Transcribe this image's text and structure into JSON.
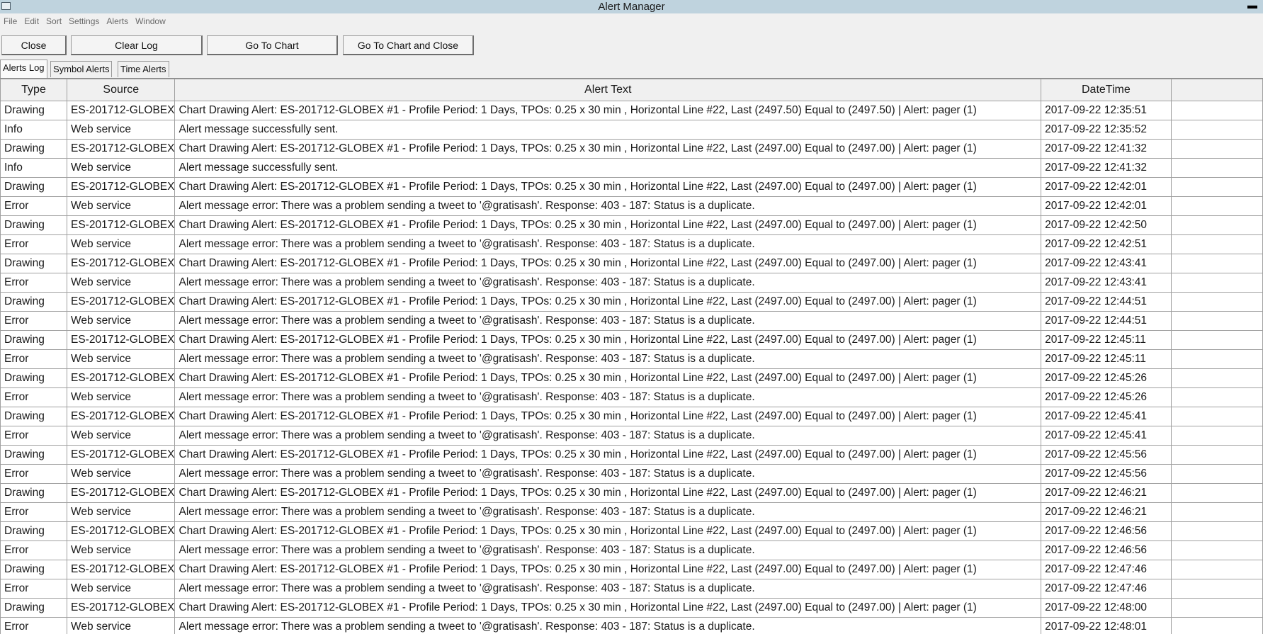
{
  "window": {
    "title": "Alert Manager",
    "minimize_label": "▬"
  },
  "menu": [
    "File",
    "Edit",
    "Sort",
    "Settings",
    "Alerts",
    "Window"
  ],
  "toolbar": {
    "close": "Close",
    "clear_log": "Clear Log",
    "go_to_chart": "Go To Chart",
    "go_to_chart_close": "Go To Chart and Close"
  },
  "tabs": [
    "Alerts Log",
    "Symbol Alerts",
    "Time Alerts"
  ],
  "columns": [
    "Type",
    "Source",
    "Alert Text",
    "DateTime",
    ""
  ],
  "rows": [
    [
      "Drawing",
      "ES-201712-GLOBEX",
      "Chart Drawing Alert: ES-201712-GLOBEX  #1 - Profile Period: 1 Days, TPOs: 0.25 x 30 min  , Horizontal Line #22, Last (2497.50) Equal to (2497.50) | Alert: pager (1)",
      "2017-09-22  12:35:51"
    ],
    [
      "Info",
      "Web service",
      "Alert message successfully sent.",
      "2017-09-22  12:35:52"
    ],
    [
      "Drawing",
      "ES-201712-GLOBEX",
      "Chart Drawing Alert: ES-201712-GLOBEX  #1 - Profile Period: 1 Days, TPOs: 0.25 x 30 min  , Horizontal Line #22, Last (2497.00) Equal to (2497.00) | Alert: pager (1)",
      "2017-09-22  12:41:32"
    ],
    [
      "Info",
      "Web service",
      "Alert message successfully sent.",
      "2017-09-22  12:41:32"
    ],
    [
      "Drawing",
      "ES-201712-GLOBEX",
      "Chart Drawing Alert: ES-201712-GLOBEX  #1 - Profile Period: 1 Days, TPOs: 0.25 x 30 min  , Horizontal Line #22, Last (2497.00) Equal to (2497.00) | Alert: pager (1)",
      "2017-09-22  12:42:01"
    ],
    [
      "Error",
      "Web service",
      "Alert message error: There was a problem sending a tweet to '@gratisash'. Response: 403  - 187: Status is a duplicate.",
      "2017-09-22  12:42:01"
    ],
    [
      "Drawing",
      "ES-201712-GLOBEX",
      "Chart Drawing Alert: ES-201712-GLOBEX  #1 - Profile Period: 1 Days, TPOs: 0.25 x 30 min  , Horizontal Line #22, Last (2497.00) Equal to (2497.00) | Alert: pager (1)",
      "2017-09-22  12:42:50"
    ],
    [
      "Error",
      "Web service",
      "Alert message error: There was a problem sending a tweet to '@gratisash'. Response: 403  - 187: Status is a duplicate.",
      "2017-09-22  12:42:51"
    ],
    [
      "Drawing",
      "ES-201712-GLOBEX",
      "Chart Drawing Alert: ES-201712-GLOBEX  #1 - Profile Period: 1 Days, TPOs: 0.25 x 30 min  , Horizontal Line #22, Last (2497.00) Equal to (2497.00) | Alert: pager (1)",
      "2017-09-22  12:43:41"
    ],
    [
      "Error",
      "Web service",
      "Alert message error: There was a problem sending a tweet to '@gratisash'. Response: 403  - 187: Status is a duplicate.",
      "2017-09-22  12:43:41"
    ],
    [
      "Drawing",
      "ES-201712-GLOBEX",
      "Chart Drawing Alert: ES-201712-GLOBEX  #1 - Profile Period: 1 Days, TPOs: 0.25 x 30 min  , Horizontal Line #22, Last (2497.00) Equal to (2497.00) | Alert: pager (1)",
      "2017-09-22  12:44:51"
    ],
    [
      "Error",
      "Web service",
      "Alert message error: There was a problem sending a tweet to '@gratisash'. Response: 403  - 187: Status is a duplicate.",
      "2017-09-22  12:44:51"
    ],
    [
      "Drawing",
      "ES-201712-GLOBEX",
      "Chart Drawing Alert: ES-201712-GLOBEX  #1 - Profile Period: 1 Days, TPOs: 0.25 x 30 min  , Horizontal Line #22, Last (2497.00) Equal to (2497.00) | Alert: pager (1)",
      "2017-09-22  12:45:11"
    ],
    [
      "Error",
      "Web service",
      "Alert message error: There was a problem sending a tweet to '@gratisash'. Response: 403  - 187: Status is a duplicate.",
      "2017-09-22  12:45:11"
    ],
    [
      "Drawing",
      "ES-201712-GLOBEX",
      "Chart Drawing Alert: ES-201712-GLOBEX  #1 - Profile Period: 1 Days, TPOs: 0.25 x 30 min  , Horizontal Line #22, Last (2497.00) Equal to (2497.00) | Alert: pager (1)",
      "2017-09-22  12:45:26"
    ],
    [
      "Error",
      "Web service",
      "Alert message error: There was a problem sending a tweet to '@gratisash'. Response: 403  - 187: Status is a duplicate.",
      "2017-09-22  12:45:26"
    ],
    [
      "Drawing",
      "ES-201712-GLOBEX",
      "Chart Drawing Alert: ES-201712-GLOBEX  #1 - Profile Period: 1 Days, TPOs: 0.25 x 30 min  , Horizontal Line #22, Last (2497.00) Equal to (2497.00) | Alert: pager (1)",
      "2017-09-22  12:45:41"
    ],
    [
      "Error",
      "Web service",
      "Alert message error: There was a problem sending a tweet to '@gratisash'. Response: 403  - 187: Status is a duplicate.",
      "2017-09-22  12:45:41"
    ],
    [
      "Drawing",
      "ES-201712-GLOBEX",
      "Chart Drawing Alert: ES-201712-GLOBEX  #1 - Profile Period: 1 Days, TPOs: 0.25 x 30 min  , Horizontal Line #22, Last (2497.00) Equal to (2497.00) | Alert: pager (1)",
      "2017-09-22  12:45:56"
    ],
    [
      "Error",
      "Web service",
      "Alert message error: There was a problem sending a tweet to '@gratisash'. Response: 403  - 187: Status is a duplicate.",
      "2017-09-22  12:45:56"
    ],
    [
      "Drawing",
      "ES-201712-GLOBEX",
      "Chart Drawing Alert: ES-201712-GLOBEX  #1 - Profile Period: 1 Days, TPOs: 0.25 x 30 min  , Horizontal Line #22, Last (2497.00) Equal to (2497.00) | Alert: pager (1)",
      "2017-09-22  12:46:21"
    ],
    [
      "Error",
      "Web service",
      "Alert message error: There was a problem sending a tweet to '@gratisash'. Response: 403  - 187: Status is a duplicate.",
      "2017-09-22  12:46:21"
    ],
    [
      "Drawing",
      "ES-201712-GLOBEX",
      "Chart Drawing Alert: ES-201712-GLOBEX  #1 - Profile Period: 1 Days, TPOs: 0.25 x 30 min  , Horizontal Line #22, Last (2497.00) Equal to (2497.00) | Alert: pager (1)",
      "2017-09-22  12:46:56"
    ],
    [
      "Error",
      "Web service",
      "Alert message error: There was a problem sending a tweet to '@gratisash'. Response: 403  - 187: Status is a duplicate.",
      "2017-09-22  12:46:56"
    ],
    [
      "Drawing",
      "ES-201712-GLOBEX",
      "Chart Drawing Alert: ES-201712-GLOBEX  #1 - Profile Period: 1 Days, TPOs: 0.25 x 30 min  , Horizontal Line #22, Last (2497.00) Equal to (2497.00) | Alert: pager (1)",
      "2017-09-22  12:47:46"
    ],
    [
      "Error",
      "Web service",
      "Alert message error: There was a problem sending a tweet to '@gratisash'. Response: 403  - 187: Status is a duplicate.",
      "2017-09-22  12:47:46"
    ],
    [
      "Drawing",
      "ES-201712-GLOBEX",
      "Chart Drawing Alert: ES-201712-GLOBEX  #1 - Profile Period: 1 Days, TPOs: 0.25 x 30 min  , Horizontal Line #22, Last (2497.00) Equal to (2497.00) | Alert: pager (1)",
      "2017-09-22  12:48:00"
    ],
    [
      "Error",
      "Web service",
      "Alert message error: There was a problem sending a tweet to '@gratisash'. Response: 403  - 187: Status is a duplicate.",
      "2017-09-22  12:48:01"
    ]
  ]
}
